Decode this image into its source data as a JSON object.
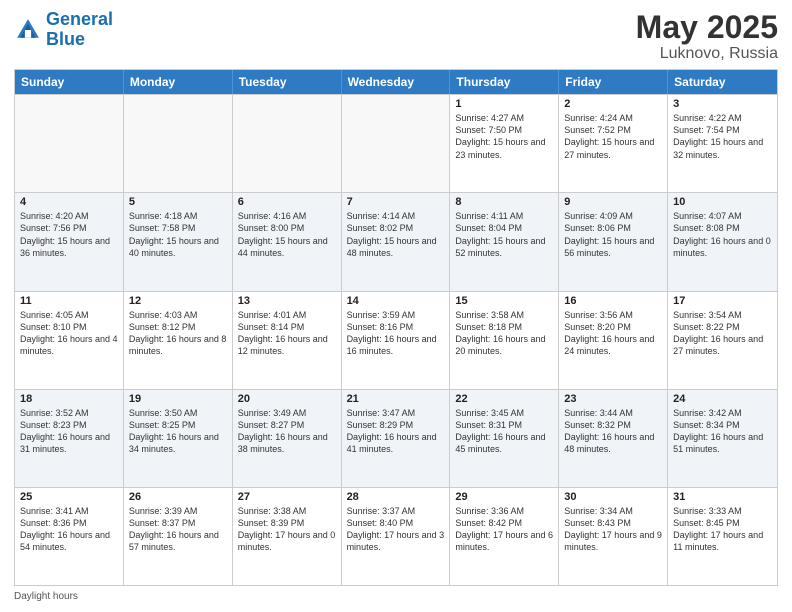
{
  "header": {
    "logo_line1": "General",
    "logo_line2": "Blue",
    "month_year": "May 2025",
    "location": "Luknovo, Russia"
  },
  "days_of_week": [
    "Sunday",
    "Monday",
    "Tuesday",
    "Wednesday",
    "Thursday",
    "Friday",
    "Saturday"
  ],
  "weeks": [
    [
      {
        "day": "",
        "sunrise": "",
        "sunset": "",
        "daylight": "",
        "empty": true
      },
      {
        "day": "",
        "sunrise": "",
        "sunset": "",
        "daylight": "",
        "empty": true
      },
      {
        "day": "",
        "sunrise": "",
        "sunset": "",
        "daylight": "",
        "empty": true
      },
      {
        "day": "",
        "sunrise": "",
        "sunset": "",
        "daylight": "",
        "empty": true
      },
      {
        "day": "1",
        "sunrise": "Sunrise: 4:27 AM",
        "sunset": "Sunset: 7:50 PM",
        "daylight": "Daylight: 15 hours and 23 minutes.",
        "empty": false
      },
      {
        "day": "2",
        "sunrise": "Sunrise: 4:24 AM",
        "sunset": "Sunset: 7:52 PM",
        "daylight": "Daylight: 15 hours and 27 minutes.",
        "empty": false
      },
      {
        "day": "3",
        "sunrise": "Sunrise: 4:22 AM",
        "sunset": "Sunset: 7:54 PM",
        "daylight": "Daylight: 15 hours and 32 minutes.",
        "empty": false
      }
    ],
    [
      {
        "day": "4",
        "sunrise": "Sunrise: 4:20 AM",
        "sunset": "Sunset: 7:56 PM",
        "daylight": "Daylight: 15 hours and 36 minutes.",
        "empty": false
      },
      {
        "day": "5",
        "sunrise": "Sunrise: 4:18 AM",
        "sunset": "Sunset: 7:58 PM",
        "daylight": "Daylight: 15 hours and 40 minutes.",
        "empty": false
      },
      {
        "day": "6",
        "sunrise": "Sunrise: 4:16 AM",
        "sunset": "Sunset: 8:00 PM",
        "daylight": "Daylight: 15 hours and 44 minutes.",
        "empty": false
      },
      {
        "day": "7",
        "sunrise": "Sunrise: 4:14 AM",
        "sunset": "Sunset: 8:02 PM",
        "daylight": "Daylight: 15 hours and 48 minutes.",
        "empty": false
      },
      {
        "day": "8",
        "sunrise": "Sunrise: 4:11 AM",
        "sunset": "Sunset: 8:04 PM",
        "daylight": "Daylight: 15 hours and 52 minutes.",
        "empty": false
      },
      {
        "day": "9",
        "sunrise": "Sunrise: 4:09 AM",
        "sunset": "Sunset: 8:06 PM",
        "daylight": "Daylight: 15 hours and 56 minutes.",
        "empty": false
      },
      {
        "day": "10",
        "sunrise": "Sunrise: 4:07 AM",
        "sunset": "Sunset: 8:08 PM",
        "daylight": "Daylight: 16 hours and 0 minutes.",
        "empty": false
      }
    ],
    [
      {
        "day": "11",
        "sunrise": "Sunrise: 4:05 AM",
        "sunset": "Sunset: 8:10 PM",
        "daylight": "Daylight: 16 hours and 4 minutes.",
        "empty": false
      },
      {
        "day": "12",
        "sunrise": "Sunrise: 4:03 AM",
        "sunset": "Sunset: 8:12 PM",
        "daylight": "Daylight: 16 hours and 8 minutes.",
        "empty": false
      },
      {
        "day": "13",
        "sunrise": "Sunrise: 4:01 AM",
        "sunset": "Sunset: 8:14 PM",
        "daylight": "Daylight: 16 hours and 12 minutes.",
        "empty": false
      },
      {
        "day": "14",
        "sunrise": "Sunrise: 3:59 AM",
        "sunset": "Sunset: 8:16 PM",
        "daylight": "Daylight: 16 hours and 16 minutes.",
        "empty": false
      },
      {
        "day": "15",
        "sunrise": "Sunrise: 3:58 AM",
        "sunset": "Sunset: 8:18 PM",
        "daylight": "Daylight: 16 hours and 20 minutes.",
        "empty": false
      },
      {
        "day": "16",
        "sunrise": "Sunrise: 3:56 AM",
        "sunset": "Sunset: 8:20 PM",
        "daylight": "Daylight: 16 hours and 24 minutes.",
        "empty": false
      },
      {
        "day": "17",
        "sunrise": "Sunrise: 3:54 AM",
        "sunset": "Sunset: 8:22 PM",
        "daylight": "Daylight: 16 hours and 27 minutes.",
        "empty": false
      }
    ],
    [
      {
        "day": "18",
        "sunrise": "Sunrise: 3:52 AM",
        "sunset": "Sunset: 8:23 PM",
        "daylight": "Daylight: 16 hours and 31 minutes.",
        "empty": false
      },
      {
        "day": "19",
        "sunrise": "Sunrise: 3:50 AM",
        "sunset": "Sunset: 8:25 PM",
        "daylight": "Daylight: 16 hours and 34 minutes.",
        "empty": false
      },
      {
        "day": "20",
        "sunrise": "Sunrise: 3:49 AM",
        "sunset": "Sunset: 8:27 PM",
        "daylight": "Daylight: 16 hours and 38 minutes.",
        "empty": false
      },
      {
        "day": "21",
        "sunrise": "Sunrise: 3:47 AM",
        "sunset": "Sunset: 8:29 PM",
        "daylight": "Daylight: 16 hours and 41 minutes.",
        "empty": false
      },
      {
        "day": "22",
        "sunrise": "Sunrise: 3:45 AM",
        "sunset": "Sunset: 8:31 PM",
        "daylight": "Daylight: 16 hours and 45 minutes.",
        "empty": false
      },
      {
        "day": "23",
        "sunrise": "Sunrise: 3:44 AM",
        "sunset": "Sunset: 8:32 PM",
        "daylight": "Daylight: 16 hours and 48 minutes.",
        "empty": false
      },
      {
        "day": "24",
        "sunrise": "Sunrise: 3:42 AM",
        "sunset": "Sunset: 8:34 PM",
        "daylight": "Daylight: 16 hours and 51 minutes.",
        "empty": false
      }
    ],
    [
      {
        "day": "25",
        "sunrise": "Sunrise: 3:41 AM",
        "sunset": "Sunset: 8:36 PM",
        "daylight": "Daylight: 16 hours and 54 minutes.",
        "empty": false
      },
      {
        "day": "26",
        "sunrise": "Sunrise: 3:39 AM",
        "sunset": "Sunset: 8:37 PM",
        "daylight": "Daylight: 16 hours and 57 minutes.",
        "empty": false
      },
      {
        "day": "27",
        "sunrise": "Sunrise: 3:38 AM",
        "sunset": "Sunset: 8:39 PM",
        "daylight": "Daylight: 17 hours and 0 minutes.",
        "empty": false
      },
      {
        "day": "28",
        "sunrise": "Sunrise: 3:37 AM",
        "sunset": "Sunset: 8:40 PM",
        "daylight": "Daylight: 17 hours and 3 minutes.",
        "empty": false
      },
      {
        "day": "29",
        "sunrise": "Sunrise: 3:36 AM",
        "sunset": "Sunset: 8:42 PM",
        "daylight": "Daylight: 17 hours and 6 minutes.",
        "empty": false
      },
      {
        "day": "30",
        "sunrise": "Sunrise: 3:34 AM",
        "sunset": "Sunset: 8:43 PM",
        "daylight": "Daylight: 17 hours and 9 minutes.",
        "empty": false
      },
      {
        "day": "31",
        "sunrise": "Sunrise: 3:33 AM",
        "sunset": "Sunset: 8:45 PM",
        "daylight": "Daylight: 17 hours and 11 minutes.",
        "empty": false
      }
    ]
  ],
  "footer": {
    "daylight_label": "Daylight hours"
  }
}
